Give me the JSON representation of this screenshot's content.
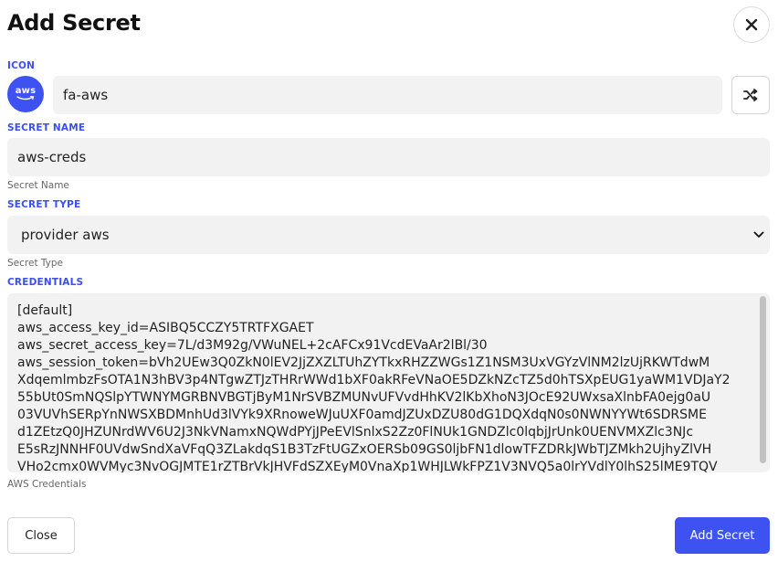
{
  "dialog": {
    "title": "Add Secret"
  },
  "icon": {
    "label": "ICON",
    "value": "fa-aws",
    "badge_text": "aws"
  },
  "secret_name": {
    "label": "SECRET NAME",
    "value": "aws-creds",
    "hint": "Secret Name"
  },
  "secret_type": {
    "label": "SECRET TYPE",
    "value": "provider aws",
    "hint": "Secret Type"
  },
  "credentials": {
    "label": "CREDENTIALS",
    "hint": "AWS Credentials",
    "value": "[default]\naws_access_key_id=ASIBQ5CCZY5TRTFXGAET\naws_secret_access_key=7L/d3M92g/VWuNEL+2cAFCx91VcdEVaAr2lBl/30\naws_session_token=bVh2UEw3Q0ZkN0lEV2JjZXZLTUhZYTkxRHZZWGs1Z1NSM3UxVGYzVlNM2lzUjRKWTdwM\nXdqemlmbzFsOTA1N3hBV3p4NTgwZTJzTHRrWWd1bXF0akRFeVNaOE5DZkNZcTZ5d0hTSXpEUG1yaWM1VDJaY2\n55bUt0SmNQSlpYTWNYMGRBNVBGTjByM1NrSVBZMUNvUFVvdHhKV2lKbXhoN3JOcE92UWxsaXlnbFA0ejg0aU\n03VUVhSERpYnNWSXBDMnhUd3lVYk9XRnoweWJuUXF0amdJZUxDZU80dG1DQXdqN0s0NWNYYWt6SDRSME\nd1ZEtzQ0JHZUNrdWV6U2J3NkVNamxNQWdPYjJPeEVlSnlxS2Zz0FlNUk1GNDZlc0lqbjJrUnk0UENVMXZlc3NJc\nE5sRzJNNHF0UVdwSndXaVFqQ3ZLakdqS1B3TzFtUGZxOERSb09GS0ljbFN1dlowTFZDRkJWbTJZMkh2UjhyZlVH\nVHo2cmx0WVMyc3NvOGJMTE1rZTBrVkJHVFdSZXEyM0VnaXp1WHJLWkFPZ1V3NVQ5a0lrYVdlY0lhS25lME9TQV"
  },
  "footer": {
    "close_label": "Close",
    "submit_label": "Add Secret"
  },
  "colors": {
    "accent": "#3d52f0",
    "label_blue": "#3b4ef5",
    "field_bg": "#f2f2f2"
  },
  "icons": {
    "dialog_close": "x-icon",
    "shuffle": "shuffle-icon",
    "select_chevron": "chevron-down-icon",
    "aws_logo": "aws-icon"
  }
}
